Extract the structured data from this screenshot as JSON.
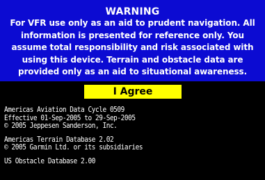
{
  "warning": {
    "title": "WARNING",
    "lines": [
      "For VFR use only as an aid to prudent navigation.  All",
      "information is presented for reference only.  You",
      "assume total responsibility and risk associated with",
      "using this device.  Terrain and obstacle data are",
      "provided only as an aid to situational awareness."
    ]
  },
  "agree": {
    "label": "I Agree"
  },
  "databases": [
    {
      "lines": [
        "Americas Aviation Data Cycle 0509",
        "Effective 01-Sep-2005 to 29-Sep-2005",
        "© 2005 Jeppesen Sanderson, Inc."
      ]
    },
    {
      "lines": [
        "Americas Terrain Database 2.02",
        "© 2005 Garmin Ltd. or its subsidiaries"
      ]
    },
    {
      "lines": [
        "US Obstacle Database 2.00"
      ]
    }
  ],
  "colors": {
    "warning_background": "#0c0bd2",
    "button_background": "#ffff00",
    "screen_background": "#000000",
    "text": "#ffffff"
  }
}
